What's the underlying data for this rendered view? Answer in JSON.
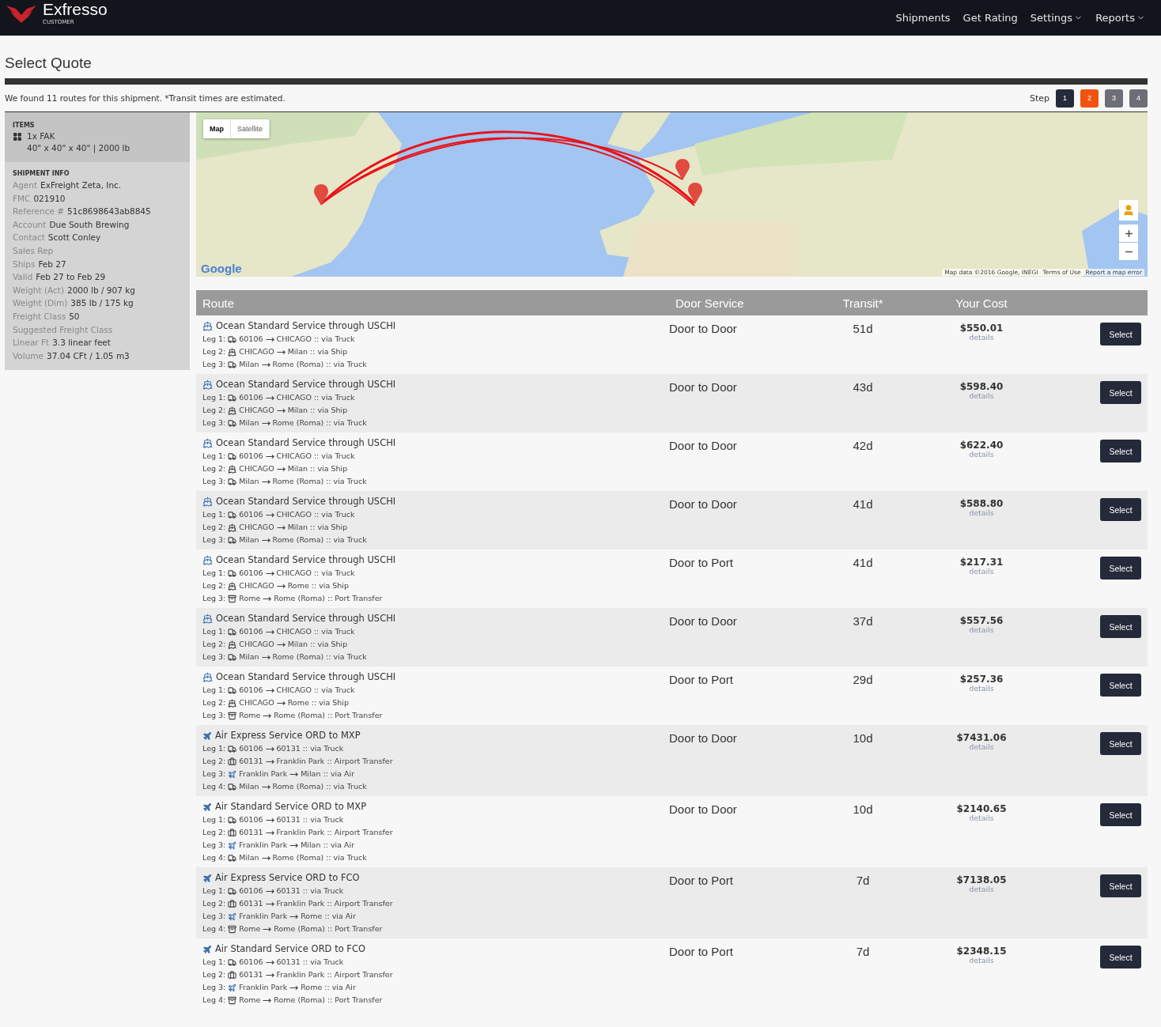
{
  "header": {
    "brand": "Exfresso",
    "sub": "CUSTOMER",
    "nav": [
      {
        "label": "Shipments",
        "dropdown": false
      },
      {
        "label": "Get Rating",
        "dropdown": false
      },
      {
        "label": "Settings",
        "dropdown": true
      },
      {
        "label": "Reports",
        "dropdown": true
      }
    ]
  },
  "page_title": "Select Quote",
  "summary": "We found 11 routes for this shipment. *Transit times are estimated.",
  "steps": {
    "label": "Step",
    "items": [
      {
        "label": "1",
        "kind": "done"
      },
      {
        "label": "2",
        "kind": "current"
      },
      {
        "label": "3",
        "kind": "todo"
      },
      {
        "label": "4",
        "kind": "todo"
      }
    ]
  },
  "sidebar": {
    "items_heading": "ITEMS",
    "item": {
      "name": "1x FAK",
      "dims": "40\" x 40\" x 40\" | 2000 lb"
    },
    "info_heading": "SHIPMENT INFO",
    "info": [
      {
        "label": "Agent",
        "value": "ExFreight Zeta, Inc."
      },
      {
        "label": "FMC",
        "value": "021910"
      },
      {
        "label": "Reference #",
        "value": "51c8698643ab8845"
      },
      {
        "label": "Account",
        "value": "Due South Brewing"
      },
      {
        "label": "Contact",
        "value": "Scott Conley"
      },
      {
        "label": "Sales Rep"
      },
      {
        "label": "Ships",
        "value": "Feb 27"
      },
      {
        "label": "Valid",
        "value": "Feb 27 to Feb 29"
      },
      {
        "label": "Weight (Act)",
        "value": "2000 lb / 907 kg"
      },
      {
        "label": "Weight (Dim)",
        "value": "385 lb / 175 kg"
      },
      {
        "label": "Freight Class",
        "value": "50"
      },
      {
        "label": "Suggested Freight Class"
      },
      {
        "label": "Linear Ft",
        "value": "3.3 linear feet"
      },
      {
        "label": "Volume",
        "value": "37.04 CFt / 1.05 m3"
      }
    ]
  },
  "map": {
    "tabs": [
      {
        "label": "Map",
        "selected": true
      },
      {
        "label": "Satellite",
        "selected": false
      }
    ],
    "logo": "Google",
    "attribution": "Map data ©2016 Google, INEGI",
    "links": [
      "Terms of Use",
      "Report a map error"
    ]
  },
  "table": {
    "columns": [
      "Route",
      "Door Service",
      "Transit*",
      "Your Cost"
    ],
    "rows": [
      {
        "kind": "ship",
        "service": "Ocean Standard Service through USCHI",
        "legs": [
          {
            "label": "Leg 1:",
            "kind": "truck",
            "from": "60106",
            "to": "CHICAGO",
            "via": ":: via Truck"
          },
          {
            "label": "Leg 2:",
            "kind": "ship",
            "from": "CHICAGO",
            "to": "Milan",
            "via": ":: via Ship"
          },
          {
            "label": "Leg 3:",
            "kind": "truck",
            "from": "Milan",
            "to": "Rome (Roma)",
            "via": ":: via Truck"
          }
        ],
        "door": "Door to Door",
        "transit": "51d",
        "cost": "$550.01",
        "details": "details",
        "action": "Select"
      },
      {
        "kind": "ship",
        "service": "Ocean Standard Service through USCHI",
        "legs": [
          {
            "label": "Leg 1:",
            "kind": "truck",
            "from": "60106",
            "to": "CHICAGO",
            "via": ":: via Truck"
          },
          {
            "label": "Leg 2:",
            "kind": "ship",
            "from": "CHICAGO",
            "to": "Milan",
            "via": ":: via Ship"
          },
          {
            "label": "Leg 3:",
            "kind": "truck",
            "from": "Milan",
            "to": "Rome (Roma)",
            "via": ":: via Truck"
          }
        ],
        "door": "Door to Door",
        "transit": "43d",
        "cost": "$598.40",
        "details": "details",
        "action": "Select"
      },
      {
        "kind": "ship",
        "service": "Ocean Standard Service through USCHI",
        "legs": [
          {
            "label": "Leg 1:",
            "kind": "truck",
            "from": "60106",
            "to": "CHICAGO",
            "via": ":: via Truck"
          },
          {
            "label": "Leg 2:",
            "kind": "ship",
            "from": "CHICAGO",
            "to": "Milan",
            "via": ":: via Ship"
          },
          {
            "label": "Leg 3:",
            "kind": "truck",
            "from": "Milan",
            "to": "Rome (Roma)",
            "via": ":: via Truck"
          }
        ],
        "door": "Door to Door",
        "transit": "42d",
        "cost": "$622.40",
        "details": "details",
        "action": "Select"
      },
      {
        "kind": "ship",
        "service": "Ocean Standard Service through USCHI",
        "legs": [
          {
            "label": "Leg 1:",
            "kind": "truck",
            "from": "60106",
            "to": "CHICAGO",
            "via": ":: via Truck"
          },
          {
            "label": "Leg 2:",
            "kind": "ship",
            "from": "CHICAGO",
            "to": "Milan",
            "via": ":: via Ship"
          },
          {
            "label": "Leg 3:",
            "kind": "truck",
            "from": "Milan",
            "to": "Rome (Roma)",
            "via": ":: via Truck"
          }
        ],
        "door": "Door to Door",
        "transit": "41d",
        "cost": "$588.80",
        "details": "details",
        "action": "Select"
      },
      {
        "kind": "ship",
        "service": "Ocean Standard Service through USCHI",
        "legs": [
          {
            "label": "Leg 1:",
            "kind": "truck",
            "from": "60106",
            "to": "CHICAGO",
            "via": ":: via Truck"
          },
          {
            "label": "Leg 2:",
            "kind": "ship",
            "from": "CHICAGO",
            "to": "Rome",
            "via": ":: via Ship"
          },
          {
            "label": "Leg 3:",
            "kind": "port",
            "from": "Rome",
            "to": "Rome (Roma)",
            "via": ":: Port Transfer"
          }
        ],
        "door": "Door to Port",
        "transit": "41d",
        "cost": "$217.31",
        "details": "details",
        "action": "Select"
      },
      {
        "kind": "ship",
        "service": "Ocean Standard Service through USCHI",
        "legs": [
          {
            "label": "Leg 1:",
            "kind": "truck",
            "from": "60106",
            "to": "CHICAGO",
            "via": ":: via Truck"
          },
          {
            "label": "Leg 2:",
            "kind": "ship",
            "from": "CHICAGO",
            "to": "Milan",
            "via": ":: via Ship"
          },
          {
            "label": "Leg 3:",
            "kind": "truck",
            "from": "Milan",
            "to": "Rome (Roma)",
            "via": ":: via Truck"
          }
        ],
        "door": "Door to Door",
        "transit": "37d",
        "cost": "$557.56",
        "details": "details",
        "action": "Select"
      },
      {
        "kind": "ship",
        "service": "Ocean Standard Service through USCHI",
        "legs": [
          {
            "label": "Leg 1:",
            "kind": "truck",
            "from": "60106",
            "to": "CHICAGO",
            "via": ":: via Truck"
          },
          {
            "label": "Leg 2:",
            "kind": "ship",
            "from": "CHICAGO",
            "to": "Rome",
            "via": ":: via Ship"
          },
          {
            "label": "Leg 3:",
            "kind": "port",
            "from": "Rome",
            "to": "Rome (Roma)",
            "via": ":: Port Transfer"
          }
        ],
        "door": "Door to Port",
        "transit": "29d",
        "cost": "$257.36",
        "details": "details",
        "action": "Select"
      },
      {
        "kind": "air",
        "service": "Air Express Service ORD to MXP",
        "legs": [
          {
            "label": "Leg 1:",
            "kind": "truck",
            "from": "60106",
            "to": "60131",
            "via": ":: via Truck"
          },
          {
            "label": "Leg 2:",
            "kind": "briefcase",
            "from": "60131",
            "to": "Franklin Park",
            "via": ":: Airport Transfer"
          },
          {
            "label": "Leg 3:",
            "kind": "air",
            "from": "Franklin Park",
            "to": "Milan",
            "via": ":: via Air"
          },
          {
            "label": "Leg 4:",
            "kind": "truck",
            "from": "Milan",
            "to": "Rome (Roma)",
            "via": ":: via Truck"
          }
        ],
        "door": "Door to Door",
        "transit": "10d",
        "cost": "$7431.06",
        "details": "details",
        "action": "Select"
      },
      {
        "kind": "air",
        "service": "Air Standard Service ORD to MXP",
        "legs": [
          {
            "label": "Leg 1:",
            "kind": "truck",
            "from": "60106",
            "to": "60131",
            "via": ":: via Truck"
          },
          {
            "label": "Leg 2:",
            "kind": "briefcase",
            "from": "60131",
            "to": "Franklin Park",
            "via": ":: Airport Transfer"
          },
          {
            "label": "Leg 3:",
            "kind": "air",
            "from": "Franklin Park",
            "to": "Milan",
            "via": ":: via Air"
          },
          {
            "label": "Leg 4:",
            "kind": "truck",
            "from": "Milan",
            "to": "Rome (Roma)",
            "via": ":: via Truck"
          }
        ],
        "door": "Door to Door",
        "transit": "10d",
        "cost": "$2140.65",
        "details": "details",
        "action": "Select"
      },
      {
        "kind": "air",
        "service": "Air Express Service ORD to FCO",
        "legs": [
          {
            "label": "Leg 1:",
            "kind": "truck",
            "from": "60106",
            "to": "60131",
            "via": ":: via Truck"
          },
          {
            "label": "Leg 2:",
            "kind": "briefcase",
            "from": "60131",
            "to": "Franklin Park",
            "via": ":: Airport Transfer"
          },
          {
            "label": "Leg 3:",
            "kind": "air",
            "from": "Franklin Park",
            "to": "Rome",
            "via": ":: via Air"
          },
          {
            "label": "Leg 4:",
            "kind": "port",
            "from": "Rome",
            "to": "Rome (Roma)",
            "via": ":: Port Transfer"
          }
        ],
        "door": "Door to Port",
        "transit": "7d",
        "cost": "$7138.05",
        "details": "details",
        "action": "Select"
      },
      {
        "kind": "air",
        "service": "Air Standard Service ORD to FCO",
        "legs": [
          {
            "label": "Leg 1:",
            "kind": "truck",
            "from": "60106",
            "to": "60131",
            "via": ":: via Truck"
          },
          {
            "label": "Leg 2:",
            "kind": "briefcase",
            "from": "60131",
            "to": "Franklin Park",
            "via": ":: Airport Transfer"
          },
          {
            "label": "Leg 3:",
            "kind": "air",
            "from": "Franklin Park",
            "to": "Rome",
            "via": ":: via Air"
          },
          {
            "label": "Leg 4:",
            "kind": "port",
            "from": "Rome",
            "to": "Rome (Roma)",
            "via": ":: Port Transfer"
          }
        ],
        "door": "Door to Port",
        "transit": "7d",
        "cost": "$2348.15",
        "details": "details",
        "action": "Select"
      }
    ]
  }
}
